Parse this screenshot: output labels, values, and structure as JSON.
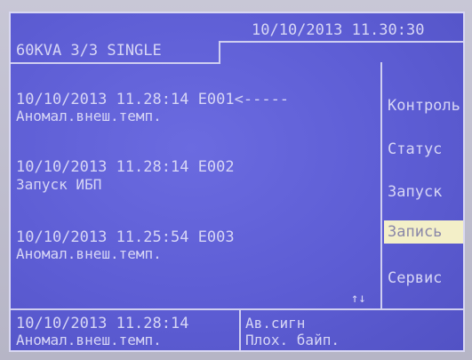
{
  "header": {
    "datetime": "10/10/2013  11.30:30",
    "model": "60KVA 3/3  SINGLE"
  },
  "events": [
    {
      "line1": "10/10/2013 11.28:14 E001<-----",
      "line2": "Аномал.внеш.темп."
    },
    {
      "line1": "10/10/2013 11.28:14 E002",
      "line2": "Запуск ИБП"
    },
    {
      "line1": "10/10/2013 11.25:54 E003",
      "line2": "Аномал.внеш.темп."
    }
  ],
  "scroll_indicator": "↑↓",
  "menu": [
    {
      "label": "Контроль",
      "selected": false
    },
    {
      "label": "Статус",
      "selected": false
    },
    {
      "label": "Запуск",
      "selected": false
    },
    {
      "label": "Запись",
      "selected": true
    },
    {
      "label": "Сервис",
      "selected": false
    }
  ],
  "footer": {
    "last_event_time": "10/10/2013   11.28:14",
    "last_event_desc": "Аномал.внеш.темп.",
    "alarm_label": "Ав.сигн",
    "alarm_desc": "Плох. байп."
  }
}
